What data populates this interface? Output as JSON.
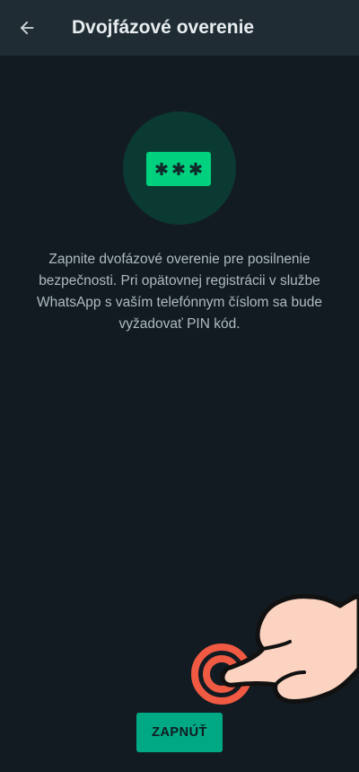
{
  "header": {
    "title": "Dvojfázové overenie",
    "back_icon": "arrow-left-icon"
  },
  "illustration": {
    "icon": "pin-asterisks-icon",
    "pin_mask": "***",
    "colors": {
      "circle": "#0b3a33",
      "pin_box": "#00d17e"
    }
  },
  "main": {
    "description": "Zapnite dvofázové overenie pre posilnenie bezpečnosti. Pri opätovnej registrácii v službe WhatsApp s vaším telefónnym číslom sa bude vyžadovať PIN kód."
  },
  "actions": {
    "enable_label": "ZAPNÚŤ"
  },
  "overlay": {
    "icon": "tap-hand-icon"
  },
  "colors": {
    "background": "#121b22",
    "app_bar": "#1f2c34",
    "accent": "#00a884",
    "tap_ring": "#f05a43",
    "hand_fill": "#fbd3c0"
  }
}
